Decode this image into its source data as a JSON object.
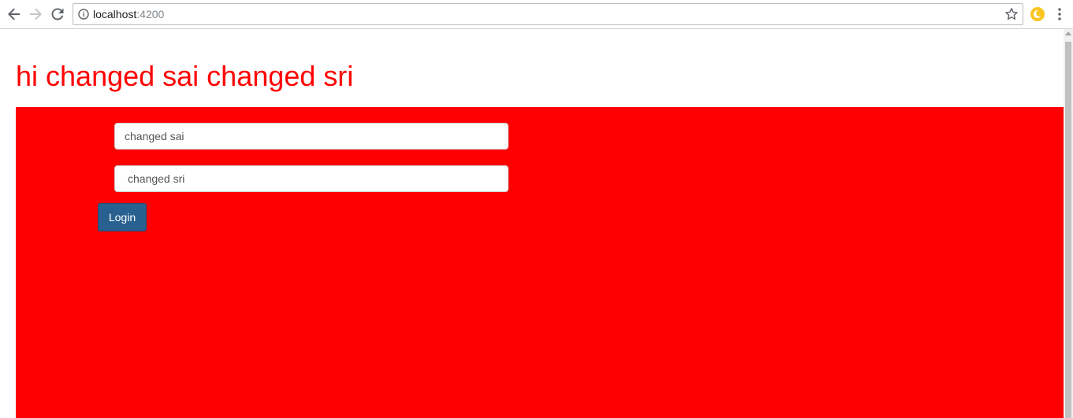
{
  "browser": {
    "url_host": "localhost",
    "url_port": ":4200",
    "icons": {
      "back": "arrow-left-icon",
      "forward": "arrow-right-icon",
      "reload": "reload-icon",
      "site_info": "info-icon",
      "bookmark": "star-icon",
      "extension": "crescent-moon-icon",
      "menu": "kebab-menu-icon"
    }
  },
  "page": {
    "heading": "hi changed sai changed sri",
    "heading_color": "#ff0000",
    "panel_color": "#ff0000",
    "form": {
      "first_field_value": "changed sai",
      "second_field_value": "changed sri",
      "login_label": "Login",
      "button_color": "#286090"
    }
  }
}
